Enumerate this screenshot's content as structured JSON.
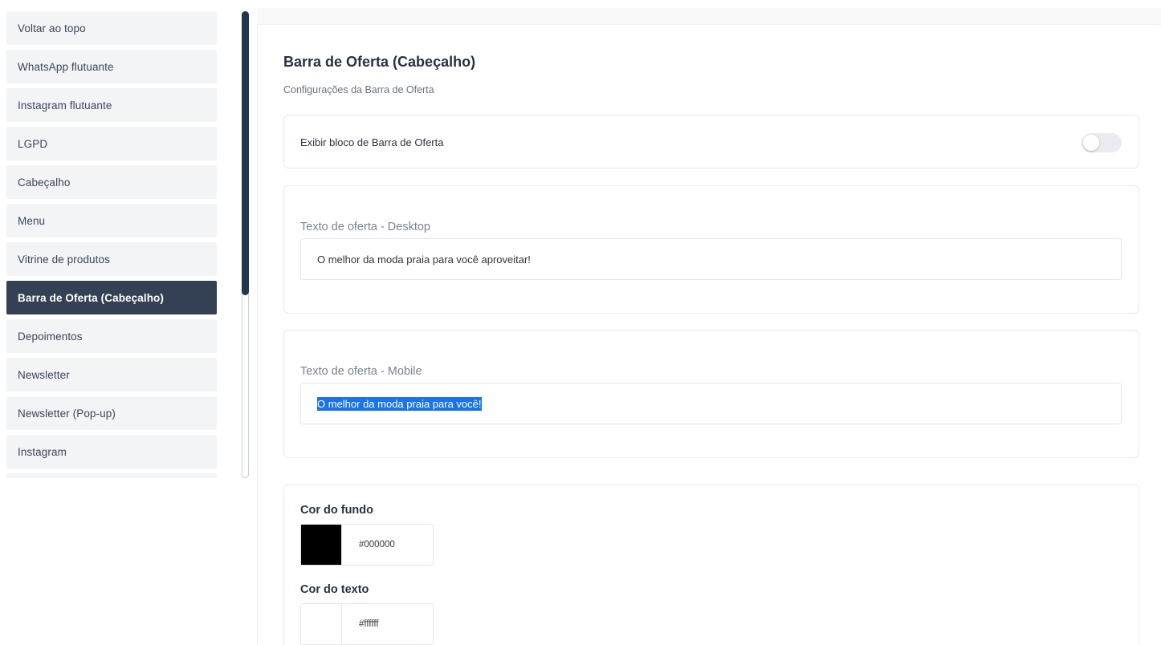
{
  "sidebar": {
    "items": [
      {
        "label": "Voltar ao topo"
      },
      {
        "label": "WhatsApp flutuante"
      },
      {
        "label": "Instagram flutuante"
      },
      {
        "label": "LGPD"
      },
      {
        "label": "Cabeçalho"
      },
      {
        "label": "Menu"
      },
      {
        "label": "Vitrine de produtos"
      },
      {
        "label": "Barra de Oferta (Cabeçalho)",
        "active": true
      },
      {
        "label": "Depoimentos"
      },
      {
        "label": "Newsletter"
      },
      {
        "label": "Newsletter (Pop-up)"
      },
      {
        "label": "Instagram"
      }
    ]
  },
  "main": {
    "title": "Barra de Oferta (Cabeçalho)",
    "subtitle": "Configurações da Barra de Oferta",
    "toggle": {
      "label": "Exibir bloco de Barra de Oferta",
      "enabled": false
    },
    "desktop": {
      "label": "Texto de oferta - Desktop",
      "value": "O melhor da moda praia para você aproveitar!"
    },
    "mobile": {
      "label": "Texto de oferta - Mobile",
      "value": "O melhor da moda praia para você!"
    },
    "colors": {
      "bg": {
        "label": "Cor do fundo",
        "value": "#000000",
        "swatch": "#000000"
      },
      "text": {
        "label": "Cor do texto",
        "value": "#ffffff",
        "swatch": "#ffffff"
      }
    }
  }
}
